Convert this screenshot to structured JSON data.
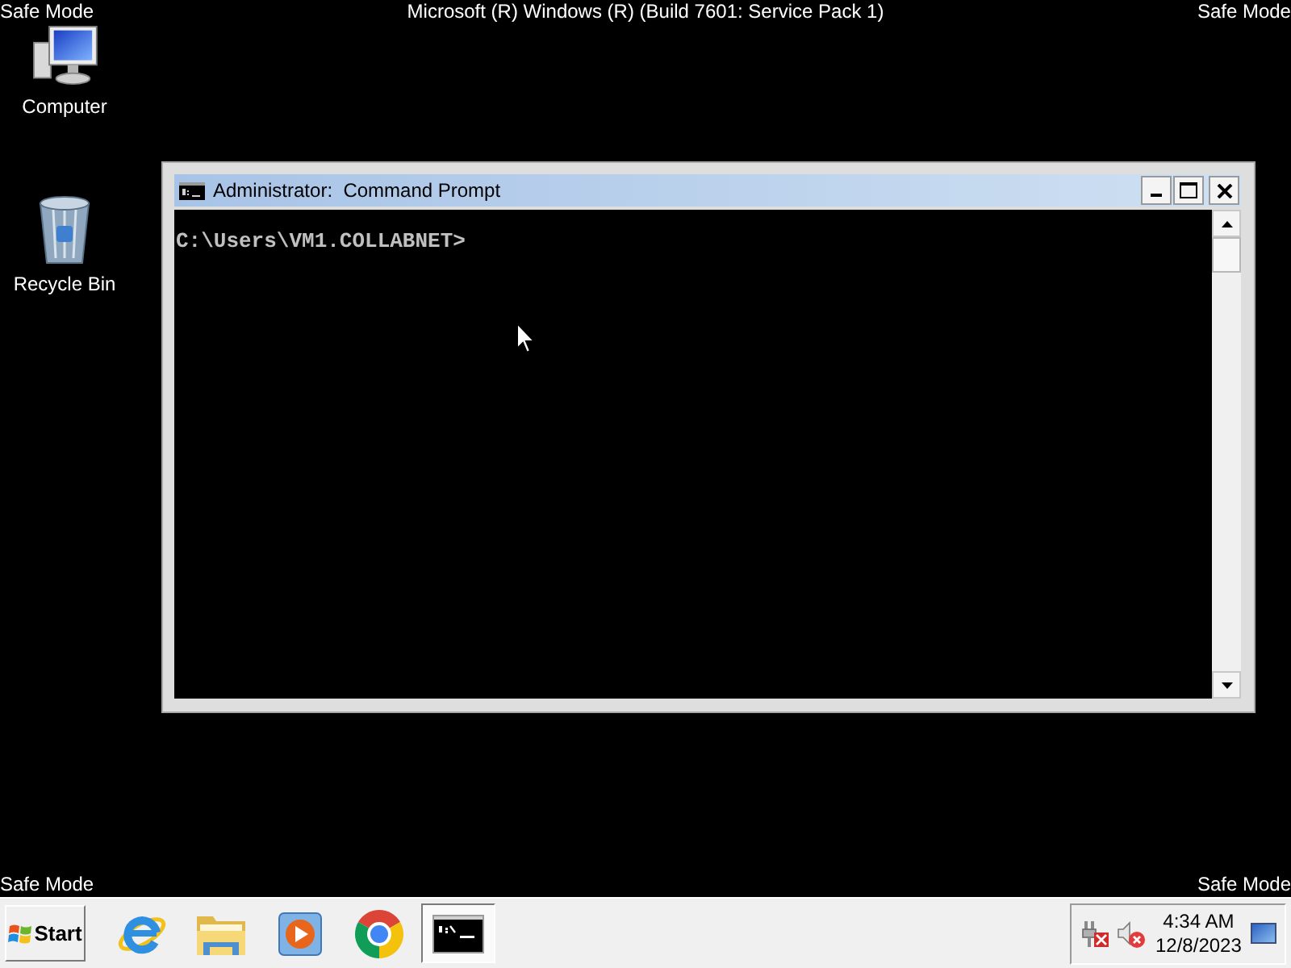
{
  "overlay": {
    "top_left": "Safe Mode",
    "top_center": "Microsoft (R) Windows (R) (Build 7601: Service Pack 1)",
    "top_right": "Safe Mode",
    "bottom_left": "Safe Mode",
    "bottom_right": "Safe Mode"
  },
  "desktop_icons": [
    {
      "kind": "computer",
      "label": "Computer"
    },
    {
      "kind": "recycle_bin",
      "label": "Recycle Bin"
    }
  ],
  "window": {
    "title": "Administrator:  Command Prompt",
    "console_lines": [
      "C:\\Users\\VM1.COLLABNET>"
    ]
  },
  "taskbar": {
    "start_button": {
      "label": "Start"
    },
    "apps": [
      {
        "kind": "internet_explorer",
        "selected": false
      },
      {
        "kind": "file_explorer",
        "selected": false
      },
      {
        "kind": "media_player",
        "selected": false
      },
      {
        "kind": "chrome",
        "selected": false
      },
      {
        "kind": "command_prompt",
        "selected": true
      }
    ],
    "tray": {
      "icons": [
        {
          "kind": "network_error"
        },
        {
          "kind": "volume_muted"
        }
      ],
      "time": "4:34 AM",
      "date": "12/8/2023"
    }
  }
}
